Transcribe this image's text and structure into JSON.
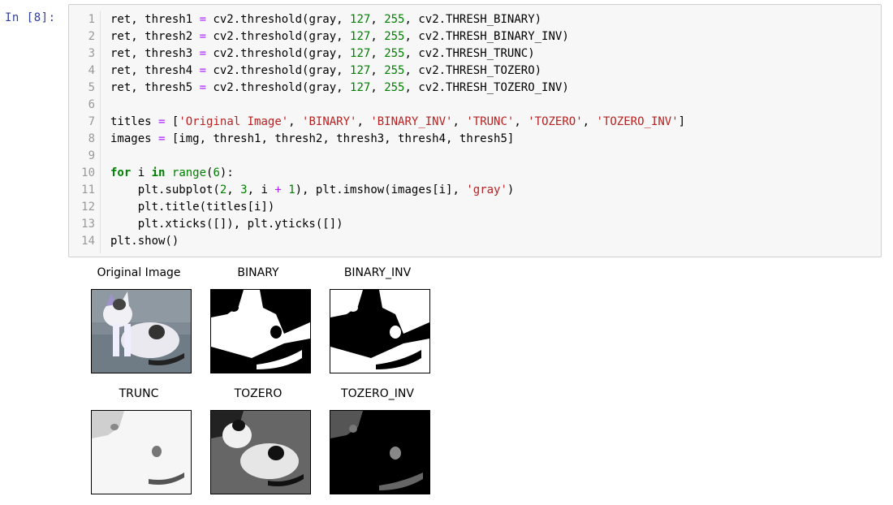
{
  "cell": {
    "prompt": "In  [8]:",
    "lines": [
      "1",
      "2",
      "3",
      "4",
      "5",
      "6",
      "7",
      "8",
      "9",
      "10",
      "11",
      "12",
      "13",
      "14"
    ]
  },
  "code": [
    [
      {
        "t": "ret, thresh1 ",
        "c": ""
      },
      {
        "t": "=",
        "c": "op"
      },
      {
        "t": " cv2.threshold(gray, ",
        "c": ""
      },
      {
        "t": "127",
        "c": "num"
      },
      {
        "t": ", ",
        "c": ""
      },
      {
        "t": "255",
        "c": "num"
      },
      {
        "t": ", cv2.THRESH_BINARY)",
        "c": ""
      }
    ],
    [
      {
        "t": "ret, thresh2 ",
        "c": ""
      },
      {
        "t": "=",
        "c": "op"
      },
      {
        "t": " cv2.threshold(gray, ",
        "c": ""
      },
      {
        "t": "127",
        "c": "num"
      },
      {
        "t": ", ",
        "c": ""
      },
      {
        "t": "255",
        "c": "num"
      },
      {
        "t": ", cv2.THRESH_BINARY_INV)",
        "c": ""
      }
    ],
    [
      {
        "t": "ret, thresh3 ",
        "c": ""
      },
      {
        "t": "=",
        "c": "op"
      },
      {
        "t": " cv2.threshold(gray, ",
        "c": ""
      },
      {
        "t": "127",
        "c": "num"
      },
      {
        "t": ", ",
        "c": ""
      },
      {
        "t": "255",
        "c": "num"
      },
      {
        "t": ", cv2.THRESH_TRUNC)",
        "c": ""
      }
    ],
    [
      {
        "t": "ret, thresh4 ",
        "c": ""
      },
      {
        "t": "=",
        "c": "op"
      },
      {
        "t": " cv2.threshold(gray, ",
        "c": ""
      },
      {
        "t": "127",
        "c": "num"
      },
      {
        "t": ", ",
        "c": ""
      },
      {
        "t": "255",
        "c": "num"
      },
      {
        "t": ", cv2.THRESH_TOZERO)",
        "c": ""
      }
    ],
    [
      {
        "t": "ret, thresh5 ",
        "c": ""
      },
      {
        "t": "=",
        "c": "op"
      },
      {
        "t": " cv2.threshold(gray, ",
        "c": ""
      },
      {
        "t": "127",
        "c": "num"
      },
      {
        "t": ", ",
        "c": ""
      },
      {
        "t": "255",
        "c": "num"
      },
      {
        "t": ", cv2.THRESH_TOZERO_INV)",
        "c": ""
      }
    ],
    [],
    [
      {
        "t": "titles ",
        "c": ""
      },
      {
        "t": "=",
        "c": "op"
      },
      {
        "t": " [",
        "c": ""
      },
      {
        "t": "'Original Image'",
        "c": "str"
      },
      {
        "t": ", ",
        "c": ""
      },
      {
        "t": "'BINARY'",
        "c": "str"
      },
      {
        "t": ", ",
        "c": ""
      },
      {
        "t": "'BINARY_INV'",
        "c": "str"
      },
      {
        "t": ", ",
        "c": ""
      },
      {
        "t": "'TRUNC'",
        "c": "str"
      },
      {
        "t": ", ",
        "c": ""
      },
      {
        "t": "'TOZERO'",
        "c": "str"
      },
      {
        "t": ", ",
        "c": ""
      },
      {
        "t": "'TOZERO_INV'",
        "c": "str"
      },
      {
        "t": "]",
        "c": ""
      }
    ],
    [
      {
        "t": "images ",
        "c": ""
      },
      {
        "t": "=",
        "c": "op"
      },
      {
        "t": " [img, thresh1, thresh2, thresh3, thresh4, thresh5]",
        "c": ""
      }
    ],
    [],
    [
      {
        "t": "for",
        "c": "kw"
      },
      {
        "t": " i ",
        "c": ""
      },
      {
        "t": "in",
        "c": "kw"
      },
      {
        "t": " ",
        "c": ""
      },
      {
        "t": "range",
        "c": "bi"
      },
      {
        "t": "(",
        "c": ""
      },
      {
        "t": "6",
        "c": "num"
      },
      {
        "t": "):",
        "c": ""
      }
    ],
    [
      {
        "t": "    plt.subplot(",
        "c": ""
      },
      {
        "t": "2",
        "c": "num"
      },
      {
        "t": ", ",
        "c": ""
      },
      {
        "t": "3",
        "c": "num"
      },
      {
        "t": ", i ",
        "c": ""
      },
      {
        "t": "+",
        "c": "op"
      },
      {
        "t": " ",
        "c": ""
      },
      {
        "t": "1",
        "c": "num"
      },
      {
        "t": "), plt.imshow(images[i], ",
        "c": ""
      },
      {
        "t": "'gray'",
        "c": "str"
      },
      {
        "t": ")",
        "c": ""
      }
    ],
    [
      {
        "t": "    plt.title(titles[i])",
        "c": ""
      }
    ],
    [
      {
        "t": "    plt.xticks([]), plt.yticks([])",
        "c": ""
      }
    ],
    [
      {
        "t": "plt.show()",
        "c": ""
      }
    ]
  ],
  "subplots": [
    {
      "title": "Original Image",
      "kind": "original"
    },
    {
      "title": "BINARY",
      "kind": "binary"
    },
    {
      "title": "BINARY_INV",
      "kind": "binary_inv"
    },
    {
      "title": "TRUNC",
      "kind": "trunc"
    },
    {
      "title": "TOZERO",
      "kind": "tozero"
    },
    {
      "title": "TOZERO_INV",
      "kind": "tozero_inv"
    }
  ]
}
